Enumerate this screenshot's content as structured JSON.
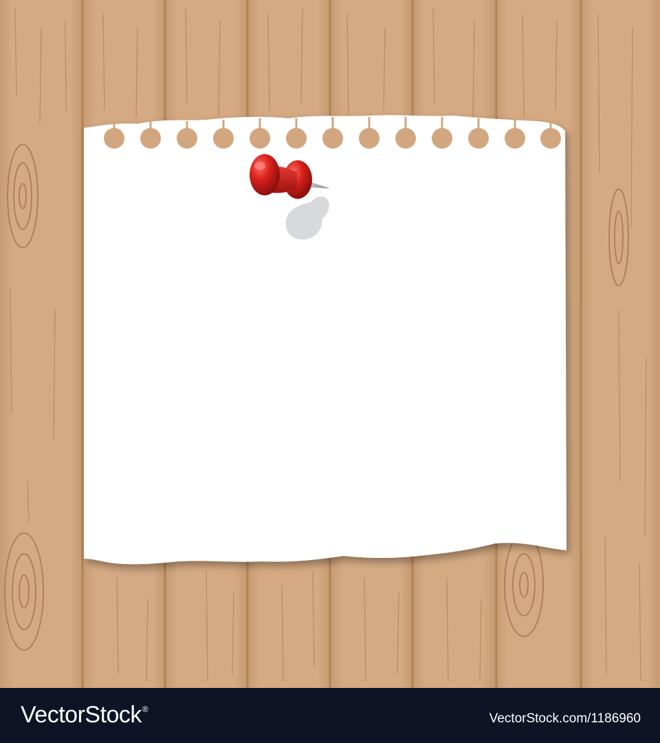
{
  "artwork": {
    "wood_color": "#d2a67f",
    "wood_seam_color": "#b68659",
    "grain_color": "#a8744c",
    "paper_color": "#ffffff",
    "pin_color": "#d41f1f",
    "hole_count": 13,
    "board_count": 8
  },
  "watermark": {
    "brand": "VectorStock",
    "registered_mark": "®",
    "image_id": "VectorStock.com/1186960",
    "background_color": "#0e1426"
  }
}
